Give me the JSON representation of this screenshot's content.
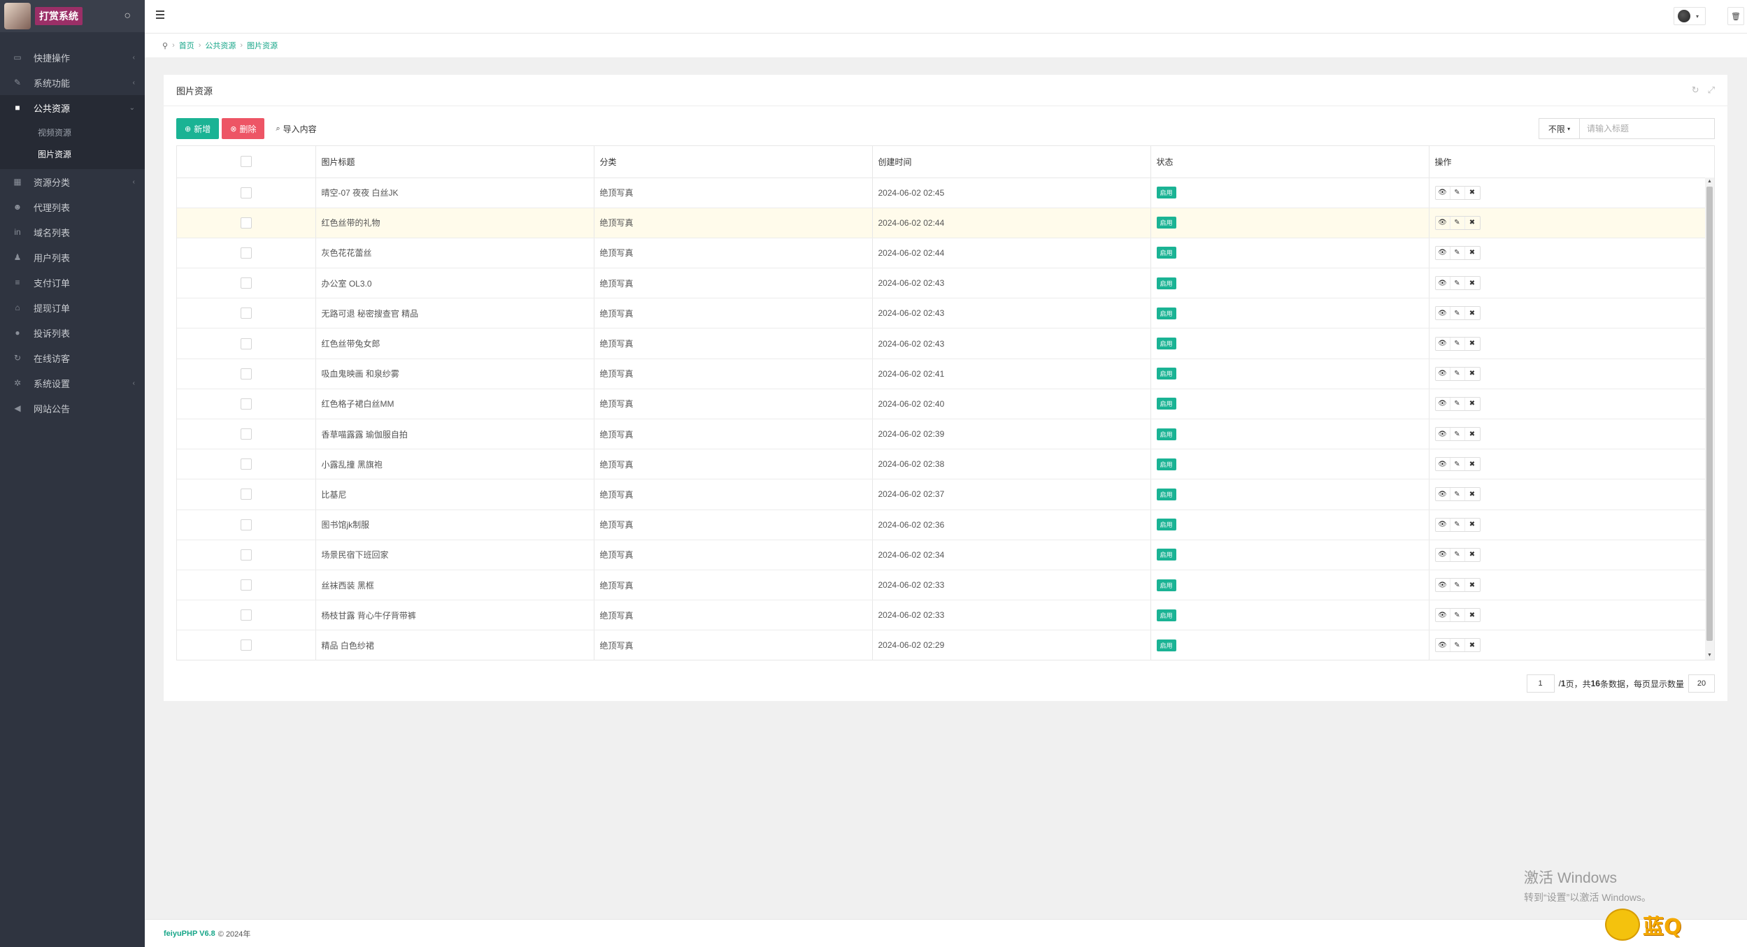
{
  "brand": {
    "title": "打赏系统"
  },
  "sidebar": {
    "items": [
      {
        "label": "快捷操作",
        "icon": "folder-icon",
        "arrow": "‹"
      },
      {
        "label": "系统功能",
        "icon": "wrench-icon",
        "arrow": "‹"
      },
      {
        "label": "公共资源",
        "icon": "video-camera-icon",
        "arrow": "⌄",
        "open": true
      },
      {
        "label": "资源分类",
        "icon": "grid-icon",
        "arrow": "‹"
      },
      {
        "label": "代理列表",
        "icon": "users-icon",
        "arrow": ""
      },
      {
        "label": "域名列表",
        "icon": "linkedin-icon",
        "arrow": ""
      },
      {
        "label": "用户列表",
        "icon": "user-icon",
        "arrow": ""
      },
      {
        "label": "支付订单",
        "icon": "list-icon",
        "arrow": ""
      },
      {
        "label": "提现订单",
        "icon": "bank-icon",
        "arrow": ""
      },
      {
        "label": "投诉列表",
        "icon": "info-icon",
        "arrow": ""
      },
      {
        "label": "在线访客",
        "icon": "refresh-icon",
        "arrow": ""
      },
      {
        "label": "系统设置",
        "icon": "gear-icon",
        "arrow": "‹"
      },
      {
        "label": "网站公告",
        "icon": "bullhorn-icon",
        "arrow": ""
      }
    ],
    "submenu": [
      {
        "label": "视频资源"
      },
      {
        "label": "图片资源",
        "active": true
      }
    ]
  },
  "breadcrumb": {
    "home": "⚲",
    "items": [
      "首页",
      "公共资源",
      "图片资源"
    ]
  },
  "panel": {
    "title": "图片资源"
  },
  "toolbar": {
    "add": "新增",
    "delete": "删除",
    "import": "导入内容"
  },
  "search": {
    "filter": "不限",
    "placeholder": "请输入标题"
  },
  "table": {
    "columns": [
      "图片标题",
      "分类",
      "创建时间",
      "状态",
      "操作"
    ],
    "rows": [
      {
        "title": "晴空-07 夜夜 白丝JK",
        "category": "绝顶写真",
        "time": "2024-06-02 02:45",
        "status": "启用"
      },
      {
        "title": "红色丝带的礼物",
        "category": "绝顶写真",
        "time": "2024-06-02 02:44",
        "status": "启用"
      },
      {
        "title": "灰色花花蕾丝",
        "category": "绝顶写真",
        "time": "2024-06-02 02:44",
        "status": "启用"
      },
      {
        "title": "办公室 OL3.0",
        "category": "绝顶写真",
        "time": "2024-06-02 02:43",
        "status": "启用"
      },
      {
        "title": "无路可退 秘密搜查官 精品",
        "category": "绝顶写真",
        "time": "2024-06-02 02:43",
        "status": "启用"
      },
      {
        "title": "红色丝带兔女郎",
        "category": "绝顶写真",
        "time": "2024-06-02 02:43",
        "status": "启用"
      },
      {
        "title": "吸血鬼映画 和泉纱雾",
        "category": "绝顶写真",
        "time": "2024-06-02 02:41",
        "status": "启用"
      },
      {
        "title": "红色格子裙白丝MM",
        "category": "绝顶写真",
        "time": "2024-06-02 02:40",
        "status": "启用"
      },
      {
        "title": "香草喵露露 瑜伽服自拍",
        "category": "绝顶写真",
        "time": "2024-06-02 02:39",
        "status": "启用"
      },
      {
        "title": "小露乱撞 黑旗袍",
        "category": "绝顶写真",
        "time": "2024-06-02 02:38",
        "status": "启用"
      },
      {
        "title": "比基尼",
        "category": "绝顶写真",
        "time": "2024-06-02 02:37",
        "status": "启用"
      },
      {
        "title": "图书馆jk制服",
        "category": "绝顶写真",
        "time": "2024-06-02 02:36",
        "status": "启用"
      },
      {
        "title": "场景民宿下班回家",
        "category": "绝顶写真",
        "time": "2024-06-02 02:34",
        "status": "启用"
      },
      {
        "title": "丝袜西装 黑框",
        "category": "绝顶写真",
        "time": "2024-06-02 02:33",
        "status": "启用"
      },
      {
        "title": "杨枝甘露 背心牛仔背带裤",
        "category": "绝顶写真",
        "time": "2024-06-02 02:33",
        "status": "启用"
      },
      {
        "title": "精品 白色纱裙",
        "category": "绝顶写真",
        "time": "2024-06-02 02:29",
        "status": "启用"
      }
    ],
    "row_actions": [
      "👁",
      "✎",
      "✖"
    ]
  },
  "pagination": {
    "page": "1",
    "text_a": "/ ",
    "total_pages": "1",
    "text_b": " 页，共 ",
    "total_records": "16",
    "text_c": " 条数据，每页显示数量",
    "page_size": "20"
  },
  "footer": {
    "brand": "feiyuPHP V6.8",
    "copyright": "© 2024年"
  },
  "watermark": {
    "title": "激活 Windows",
    "subtitle": "转到“设置”以激活 Windows。"
  },
  "corner": {
    "text": "蓝Q"
  },
  "colors": {
    "sidebar": "#2f3440",
    "accent": "#1ab394",
    "danger": "#ed5565",
    "link": "#18a689"
  }
}
